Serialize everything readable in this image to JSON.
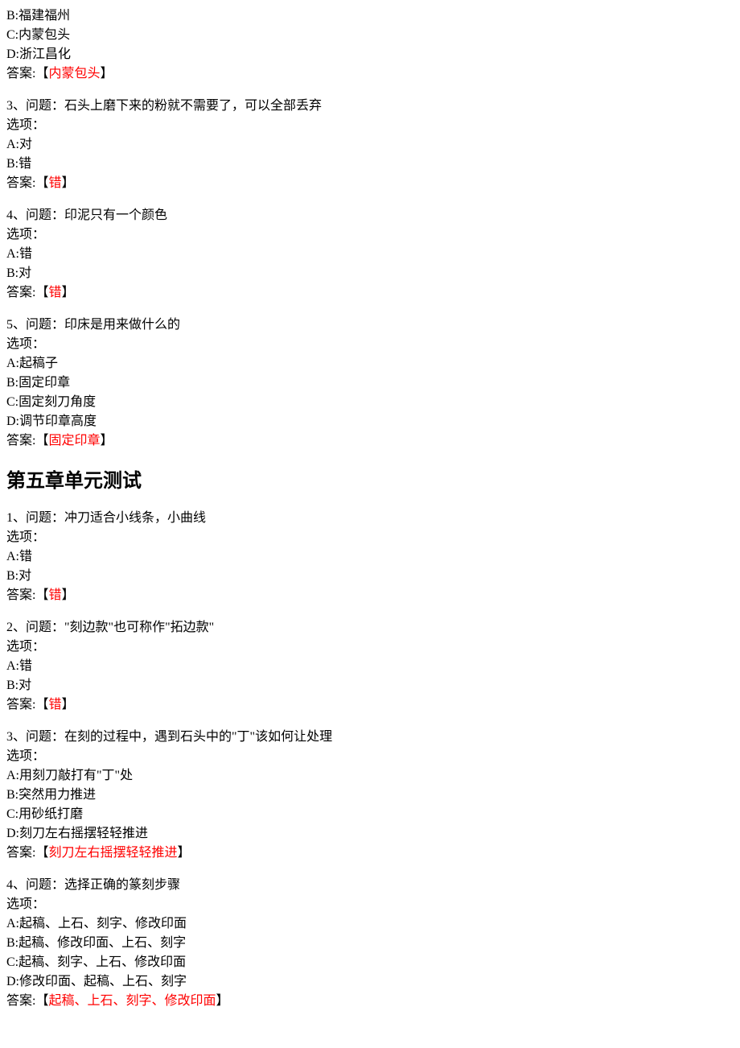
{
  "top_fragment": {
    "options": [
      "B:福建福州",
      "C:内蒙包头",
      "D:浙江昌化"
    ],
    "answer_label": "答案:",
    "bracket_open": "【",
    "answer": "内蒙包头",
    "bracket_close": "】"
  },
  "pre_chapter": [
    {
      "q_line": "3、问题：石头上磨下来的粉就不需要了，可以全部丢弃",
      "options_label": "选项：",
      "options": [
        "A:对",
        "B:错"
      ],
      "answer_label": "答案:",
      "bracket_open": "【",
      "answer": "错",
      "bracket_close": "】"
    },
    {
      "q_line": "4、问题：印泥只有一个颜色",
      "options_label": "选项：",
      "options": [
        "A:错",
        "B:对"
      ],
      "answer_label": "答案:",
      "bracket_open": "【",
      "answer": "错",
      "bracket_close": "】"
    },
    {
      "q_line": "5、问题：印床是用来做什么的",
      "options_label": "选项：",
      "options": [
        "A:起稿子",
        "B:固定印章",
        "C:固定刻刀角度",
        "D:调节印章高度"
      ],
      "answer_label": "答案:",
      "bracket_open": "【",
      "answer": "固定印章",
      "bracket_close": "】"
    }
  ],
  "chapter_title": "第五章单元测试",
  "chapter_questions": [
    {
      "q_line": "1、问题：冲刀适合小线条，小曲线",
      "options_label": "选项：",
      "options": [
        "A:错",
        "B:对"
      ],
      "answer_label": "答案:",
      "bracket_open": "【",
      "answer": "错",
      "bracket_close": "】"
    },
    {
      "q_line": "2、问题：\"刻边款\"也可称作\"拓边款\"",
      "options_label": "选项：",
      "options": [
        "A:错",
        "B:对"
      ],
      "answer_label": "答案:",
      "bracket_open": "【",
      "answer": "错",
      "bracket_close": "】"
    },
    {
      "q_line": "3、问题：在刻的过程中，遇到石头中的\"丁\"该如何让处理",
      "options_label": "选项：",
      "options": [
        "A:用刻刀敲打有\"丁\"处",
        "B:突然用力推进",
        "C:用砂纸打磨",
        "D:刻刀左右摇摆轻轻推进"
      ],
      "answer_label": "答案:",
      "bracket_open": "【",
      "answer": "刻刀左右摇摆轻轻推进",
      "bracket_close": "】"
    },
    {
      "q_line": "4、问题：选择正确的篆刻步骤",
      "options_label": "选项：",
      "options": [
        "A:起稿、上石、刻字、修改印面",
        "B:起稿、修改印面、上石、刻字",
        "C:起稿、刻字、上石、修改印面",
        "D:修改印面、起稿、上石、刻字"
      ],
      "answer_label": "答案:",
      "bracket_open": "【",
      "answer": "起稿、上石、刻字、修改印面",
      "bracket_close": "】"
    }
  ]
}
